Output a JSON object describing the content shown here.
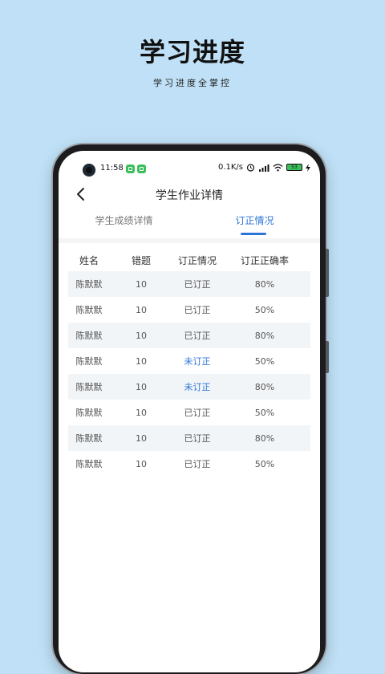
{
  "hero": {
    "title": "学习进度",
    "subtitle": "学习进度全掌控"
  },
  "status_bar": {
    "time": "11:58",
    "net_speed": "0.1K/s",
    "battery": "53"
  },
  "header": {
    "title": "学生作业详情"
  },
  "tabs": [
    {
      "label": "学生成绩详情",
      "active": false
    },
    {
      "label": "订正情况",
      "active": true
    }
  ],
  "table": {
    "columns": [
      "姓名",
      "错题",
      "订正情况",
      "订正正确率"
    ],
    "rows": [
      {
        "name": "陈默默",
        "errors": "10",
        "status": "已订正",
        "rate": "80%"
      },
      {
        "name": "陈默默",
        "errors": "10",
        "status": "已订正",
        "rate": "50%"
      },
      {
        "name": "陈默默",
        "errors": "10",
        "status": "已订正",
        "rate": "80%"
      },
      {
        "name": "陈默默",
        "errors": "10",
        "status": "未订正",
        "rate": "50%"
      },
      {
        "name": "陈默默",
        "errors": "10",
        "status": "未订正",
        "rate": "80%"
      },
      {
        "name": "陈默默",
        "errors": "10",
        "status": "已订正",
        "rate": "50%"
      },
      {
        "name": "陈默默",
        "errors": "10",
        "status": "已订正",
        "rate": "80%"
      },
      {
        "name": "陈默默",
        "errors": "10",
        "status": "已订正",
        "rate": "50%"
      }
    ]
  },
  "colors": {
    "background": "#bfe0f6",
    "accent": "#2c74d8",
    "pending_status": "#2c74d8",
    "row_shade": "#f2f5f8"
  }
}
